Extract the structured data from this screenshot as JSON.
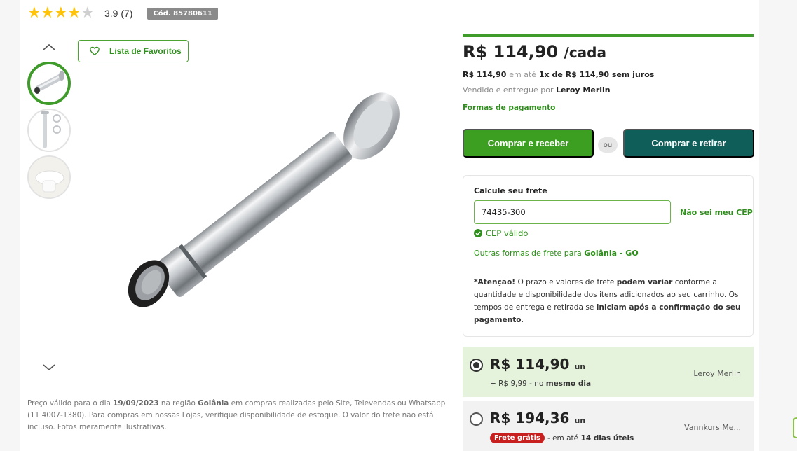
{
  "rating": {
    "filled_stars": 4,
    "total_stars": 5,
    "value_text": "3.9 (7)",
    "code": "Cód. 85780611"
  },
  "gallery": {
    "favorites_label": "Lista de Favoritos",
    "thumbnails": [
      "drain-pipe-thumbnail",
      "pipe-parts-thumbnail",
      "toilet-thumbnail"
    ],
    "selected_thumbnail": 0
  },
  "disclaimer": {
    "prefix": "Preço válido para o dia ",
    "date": "19/09/2023",
    "mid1": " na região ",
    "region": "Goiânia",
    "rest": " em compras realizadas pelo Site, Televendas ou Whatsapp (11 4007-1380). Para compras em nossas Lojas, verifique disponibilidade de estoque. O valor do frete não está incluso. Fotos meramente ilustrativas."
  },
  "price": {
    "main": "R$ 114,90",
    "unit": "/cada",
    "inst_amount": "R$ 114,90",
    "inst_mid": "em até",
    "inst_rest": "1x de R$ 114,90 sem juros",
    "seller_prefix": "Vendido e entregue por",
    "seller_name": "Leroy Merlin",
    "payment_link": "Formas de pagamento"
  },
  "actions": {
    "buy_label": "Comprar e receber",
    "or_label": "ou",
    "pickup_label": "Comprar e retirar"
  },
  "shipping": {
    "title": "Calcule seu frete",
    "cep_value": "74435-300",
    "no_cep": "Não sei meu CEP",
    "valid": "CEP válido",
    "other_prefix": "Outras formas de frete para ",
    "other_city": "Goiânia - GO",
    "att_1": "*Atenção!",
    "att_2": " O prazo e valores de frete ",
    "att_3": "podem variar",
    "att_4": " conforme a quantidade e disponibilidade dos itens adicionados ao seu carrinho. Os tempos de entrega e retirada se ",
    "att_5": "iniciam após a confirmação do seu pagamento",
    "att_6": "."
  },
  "offers": [
    {
      "price": "R$ 114,90",
      "unit": "un",
      "sub_prefix": "+ R$ 9,99 - no ",
      "sub_bold": "mesmo dia",
      "seller": "Leroy Merlin",
      "selected": true
    },
    {
      "price": "R$ 194,36",
      "unit": "un",
      "badge": "Frete grátis",
      "sub_prefix": " - em até ",
      "sub_bold": "14 dias úteis",
      "seller": "Vannkurs Me...",
      "selected": false
    }
  ],
  "colors": {
    "brand_green": "#3c9f22",
    "pickup_teal": "#0f5e5a",
    "star_yellow": "#ffc409",
    "free_badge_red": "#c8201e"
  }
}
